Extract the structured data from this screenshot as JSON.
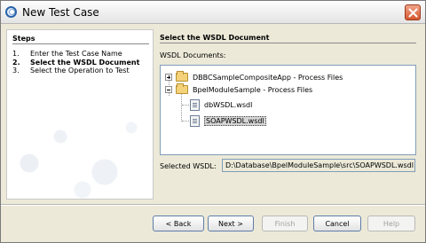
{
  "window": {
    "title": "New Test Case"
  },
  "steps": {
    "heading": "Steps",
    "items": [
      {
        "number": "1.",
        "label": "Enter the Test Case Name",
        "current": false
      },
      {
        "number": "2.",
        "label": "Select the WSDL Document",
        "current": true
      },
      {
        "number": "3.",
        "label": "Select the Operation to Test",
        "current": false
      }
    ]
  },
  "main": {
    "heading": "Select the WSDL Document",
    "documents_label": "WSDL Documents:",
    "tree": [
      {
        "label": "DBBCSampleCompositeApp - Process Files",
        "expanded": false
      },
      {
        "label": "BpelModuleSample - Process Files",
        "expanded": true,
        "children": [
          {
            "label": "dbWSDL.wsdl",
            "selected": false
          },
          {
            "label": "SOAPWSDL.wsdl",
            "selected": true
          }
        ]
      }
    ],
    "selected_wsdl_label": "Selected WSDL:",
    "selected_wsdl_value": "D:\\Database\\BpelModuleSample\\src\\SOAPWSDL.wsdl"
  },
  "buttons": {
    "back": "< Back",
    "next": "Next >",
    "finish": "Finish",
    "cancel": "Cancel",
    "help": "Help"
  }
}
